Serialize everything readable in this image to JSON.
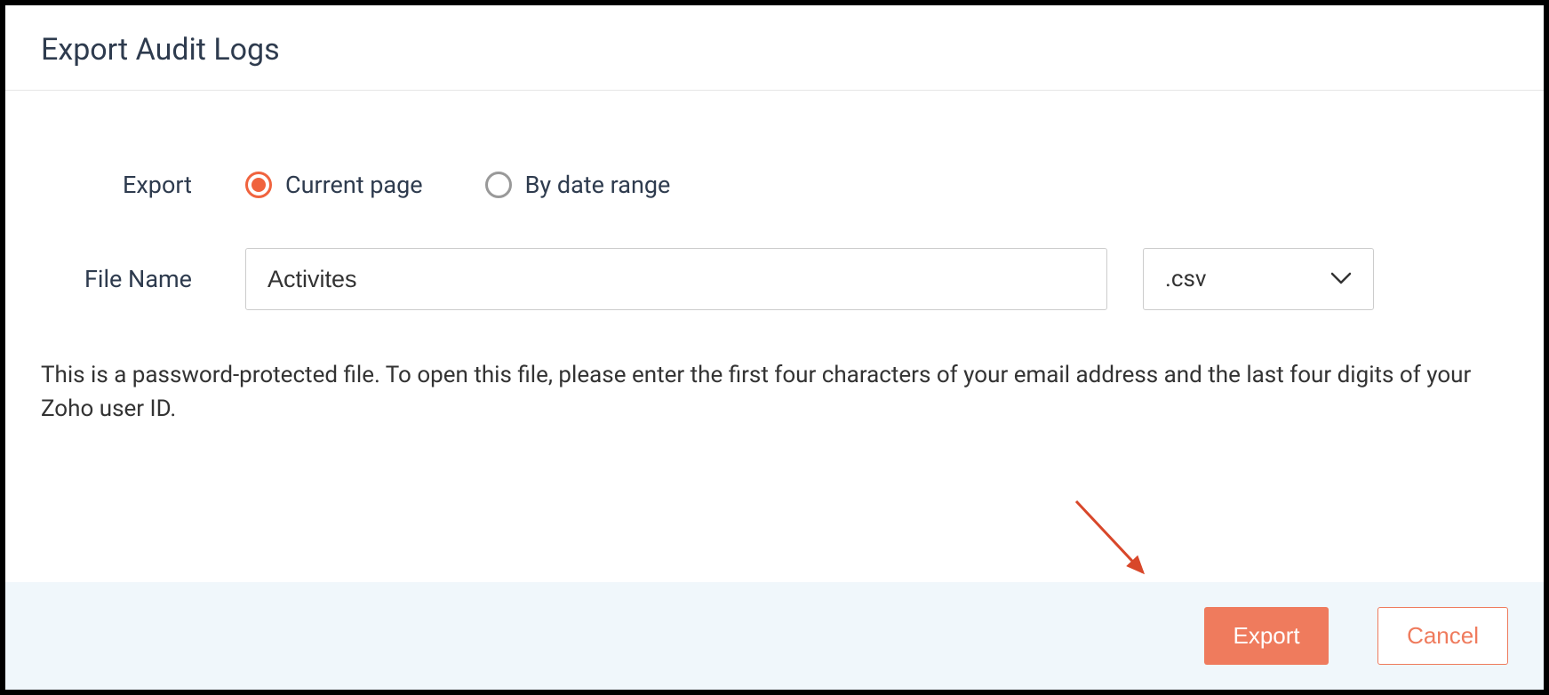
{
  "dialog": {
    "title": "Export Audit Logs",
    "exportLabel": "Export",
    "options": {
      "currentPage": "Current page",
      "byDateRange": "By date range"
    },
    "fileNameLabel": "File Name",
    "fileNameValue": "Activites",
    "fileExtension": ".csv",
    "infoText": "This is a password-protected file. To open this file, please enter the first four characters of your email address and the last four digits of your Zoho user ID.",
    "buttons": {
      "export": "Export",
      "cancel": "Cancel"
    }
  },
  "colors": {
    "accent": "#f0633e",
    "primaryBtn": "#ef7b5d"
  }
}
